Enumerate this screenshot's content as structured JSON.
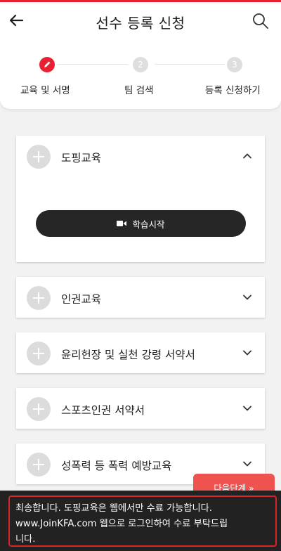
{
  "header": {
    "title": "선수 등록 신청",
    "back_icon": "arrow-left-icon",
    "search_icon": "search-icon"
  },
  "steps": [
    {
      "number": "",
      "label": "교육 및 서명",
      "state": "active",
      "icon": "pencil-icon"
    },
    {
      "number": "2",
      "label": "팀 검색",
      "state": "inactive"
    },
    {
      "number": "3",
      "label": "등록 신청하기",
      "state": "inactive"
    }
  ],
  "sections": [
    {
      "title": "도핑교육",
      "expanded": true,
      "action_label": "학습시작",
      "action_icon": "video-camera-icon"
    },
    {
      "title": "인권교육",
      "expanded": false
    },
    {
      "title": "윤리헌장 및 실천 강령 서약서",
      "expanded": false
    },
    {
      "title": "스포츠인권 서약서",
      "expanded": false
    },
    {
      "title": "성폭력 등 폭력 예방교육",
      "expanded": false
    }
  ],
  "next_button": {
    "label": "다음단계 »"
  },
  "toast": {
    "lines": [
      "최송합니다. 도핑교육은 웹에서만 수료 가능합니다.",
      "www.JoinKFA.com 웹으로 로그인하여 수료 부탁드립",
      "니다."
    ]
  },
  "colors": {
    "accent": "#e8202f",
    "next": "#ef5350",
    "toast_bg": "#222222",
    "toast_border": "#d42626"
  }
}
